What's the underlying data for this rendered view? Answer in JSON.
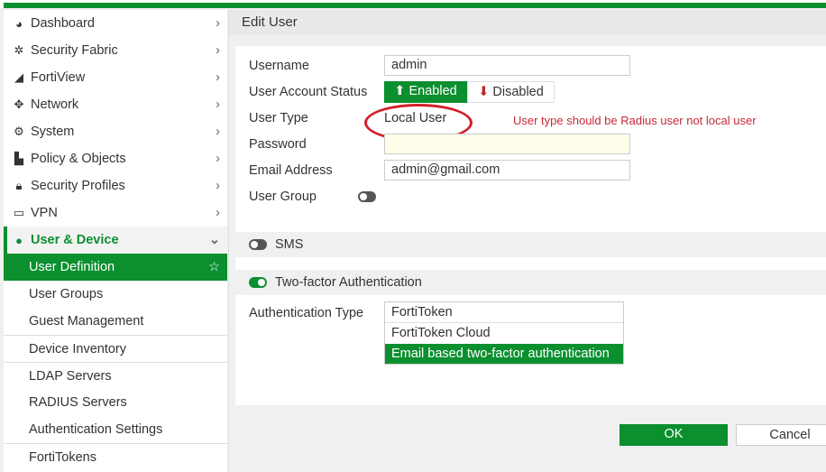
{
  "sidebar": {
    "items": [
      {
        "label": "Dashboard",
        "icon": "dashboard-icon"
      },
      {
        "label": "Security Fabric",
        "icon": "fabric-icon"
      },
      {
        "label": "FortiView",
        "icon": "chart-icon"
      },
      {
        "label": "Network",
        "icon": "move-icon"
      },
      {
        "label": "System",
        "icon": "gear-icon"
      },
      {
        "label": "Policy & Objects",
        "icon": "policy-icon"
      },
      {
        "label": "Security Profiles",
        "icon": "lock-icon"
      },
      {
        "label": "VPN",
        "icon": "laptop-icon"
      },
      {
        "label": "User & Device",
        "icon": "user-icon"
      }
    ],
    "sub": [
      "User Definition",
      "User Groups",
      "Guest Management",
      "Device Inventory",
      "LDAP Servers",
      "RADIUS Servers",
      "Authentication Settings",
      "FortiTokens"
    ]
  },
  "page": {
    "title": "Edit User",
    "labels": {
      "username": "Username",
      "status": "User Account Status",
      "type": "User Type",
      "password": "Password",
      "email": "Email Address",
      "group": "User Group",
      "sms": "SMS",
      "twofa": "Two-factor Authentication",
      "authtype": "Authentication Type"
    },
    "username": "admin",
    "enabled": "Enabled",
    "disabled": "Disabled",
    "user_type": "Local User",
    "email": "admin@gmail.com",
    "annotation": "User type should be Radius user not local user",
    "auth_options": [
      "FortiToken",
      "FortiToken Cloud",
      "Email based two-factor authentication"
    ],
    "ok": "OK",
    "cancel": "Cancel"
  }
}
